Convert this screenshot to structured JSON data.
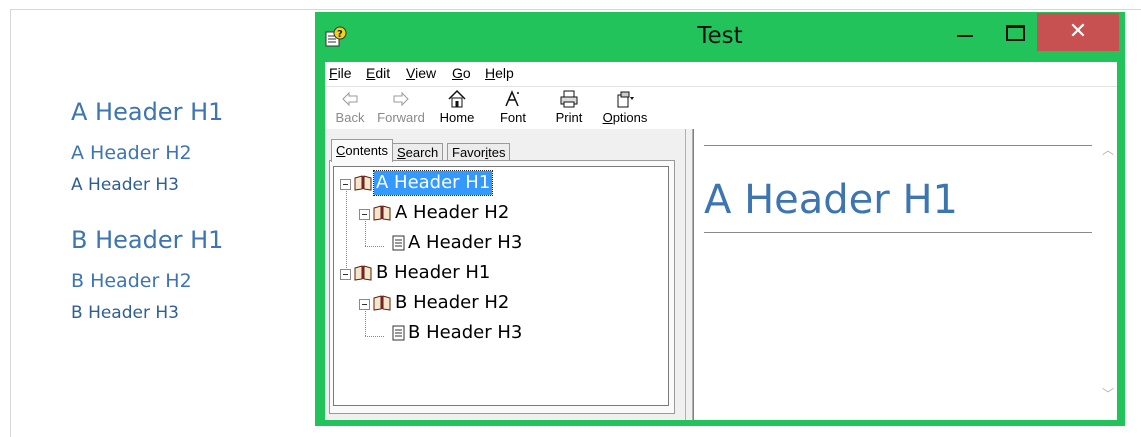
{
  "document": {
    "headings": [
      {
        "level": "H1",
        "text": "A Header H1"
      },
      {
        "level": "H2",
        "text": "A Header H2"
      },
      {
        "level": "H3",
        "text": "A Header H3"
      },
      {
        "level": "H1",
        "text": "B Header H1"
      },
      {
        "level": "H2",
        "text": "B Header H2"
      },
      {
        "level": "H3",
        "text": "B Header H3"
      }
    ]
  },
  "window": {
    "title": "Test",
    "close_glyph": "✕",
    "accent_color": "#22c35a",
    "close_color": "#c75050"
  },
  "menu": {
    "file": {
      "key": "F",
      "rest": "ile"
    },
    "edit": {
      "key": "E",
      "rest": "dit"
    },
    "view": {
      "key": "V",
      "rest": "iew"
    },
    "go": {
      "key": "G",
      "rest": "o"
    },
    "help": {
      "key": "H",
      "rest": "elp"
    }
  },
  "toolbar": {
    "back": {
      "label": "Back",
      "icon": "back-arrow-icon",
      "enabled": false
    },
    "forward": {
      "label": "Forward",
      "icon": "forward-arrow-icon",
      "enabled": false
    },
    "home": {
      "label": "Home",
      "icon": "home-icon",
      "enabled": true
    },
    "font": {
      "label": "Font",
      "icon": "font-icon",
      "enabled": true
    },
    "print": {
      "label": "Print",
      "icon": "printer-icon",
      "enabled": true
    },
    "options": {
      "label": "Options",
      "key": "O",
      "rest": "ptions",
      "icon": "options-icon",
      "enabled": true
    }
  },
  "tabs": {
    "contents": {
      "key": "C",
      "rest": "ontents",
      "active": true
    },
    "search": {
      "key": "S",
      "rest": "earch"
    },
    "favorites": {
      "pre": "Favor",
      "key": "i",
      "rest": "tes"
    }
  },
  "tree": {
    "nodes": [
      {
        "label": "A Header H1",
        "type": "book",
        "expanded": true,
        "selected": true
      },
      {
        "label": "A Header H2",
        "type": "book",
        "expanded": true
      },
      {
        "label": "A Header H3",
        "type": "page"
      },
      {
        "label": "B Header H1",
        "type": "book",
        "expanded": true
      },
      {
        "label": "B Header H2",
        "type": "book",
        "expanded": true
      },
      {
        "label": "B Header H3",
        "type": "page"
      }
    ],
    "selection_color": "#3399ff"
  },
  "content": {
    "heading": "A Header H1",
    "heading_color": "#3d75b0"
  }
}
